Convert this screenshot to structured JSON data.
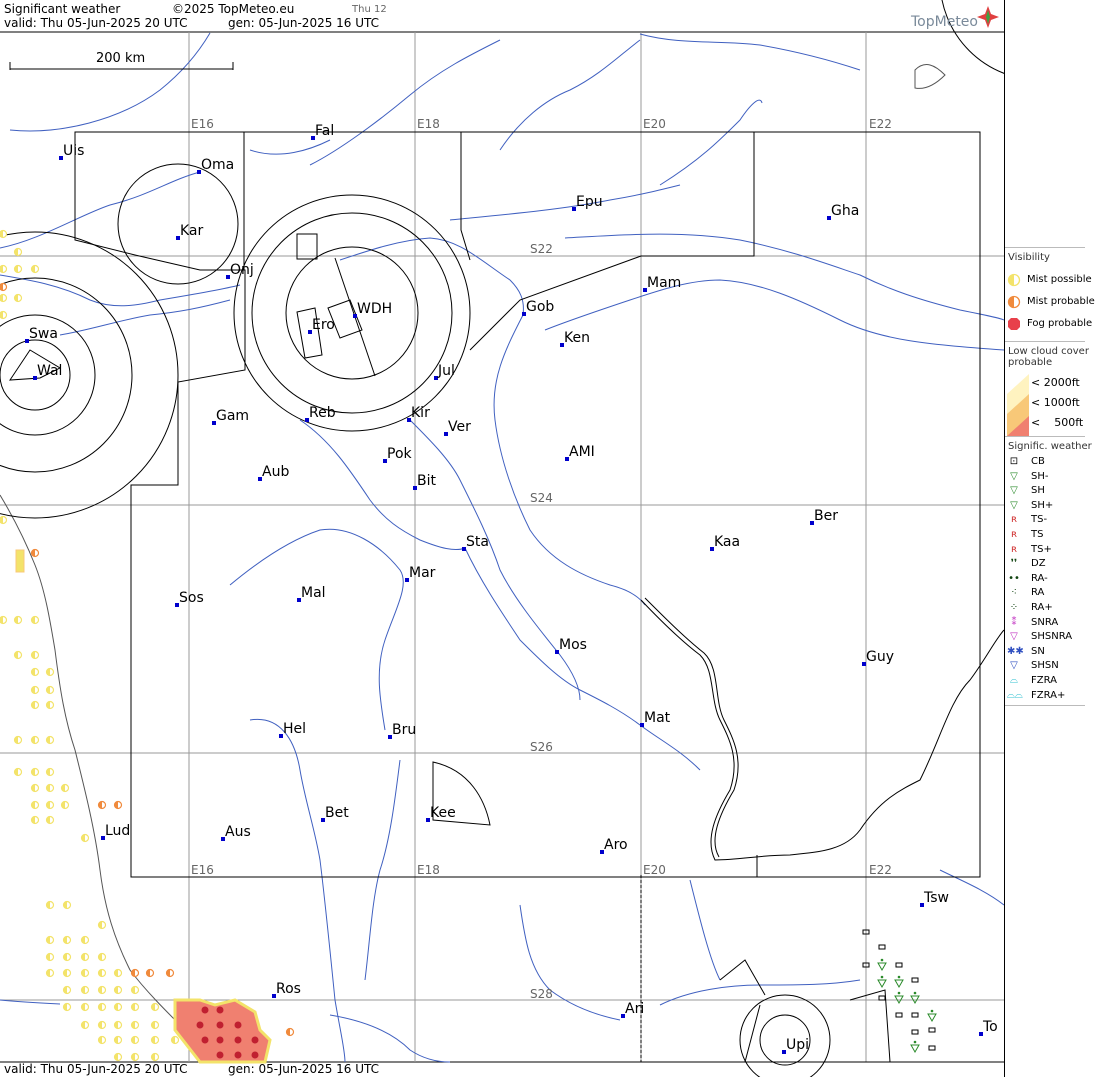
{
  "header": {
    "product": "Significant weather",
    "copyright": "©2025 TopMeteo.eu",
    "day_tag": "Thu 12",
    "valid": "valid:  Thu   05-Jun-2025  20 UTC",
    "gen": "gen: 05-Jun-2025 16 UTC",
    "logo": "TopMeteo"
  },
  "footer": {
    "valid": "valid:  Thu   05-Jun-2025  20 UTC",
    "gen": "gen: 05-Jun-2025 16 UTC"
  },
  "scale_bar": {
    "label": "200 km"
  },
  "grid": {
    "lon_labels": [
      "E16",
      "E18",
      "E20",
      "E22"
    ],
    "lat_labels": [
      "S22",
      "S24",
      "S26",
      "S28"
    ]
  },
  "cities": [
    "Uis",
    "Fal",
    "Oma",
    "Kar",
    "Onj",
    "Swa",
    "Wal",
    "Ero",
    "WDH",
    "Gob",
    "Mam",
    "Epu",
    "Gha",
    "Ken",
    "Jul",
    "Gam",
    "Reb",
    "Kir",
    "Ver",
    "Aub",
    "Pok",
    "Bit",
    "AMI",
    "Sta",
    "Kaa",
    "Ber",
    "Sos",
    "Mal",
    "Mar",
    "Mos",
    "Guy",
    "Hel",
    "Bru",
    "Mat",
    "Bet",
    "Kee",
    "Lud",
    "Aus",
    "Aro",
    "Tsw",
    "Ros",
    "Ari",
    "Upi",
    "To"
  ],
  "legend": {
    "visibility": {
      "title": "Visibility",
      "items": [
        "Mist possible",
        "Mist probable",
        "Fog probable"
      ],
      "colors": [
        "#f3e36a",
        "#f08a3c",
        "#e8404a"
      ]
    },
    "low_cloud": {
      "title": "Low cloud cover probable",
      "items": [
        "< 2000ft",
        "< 1000ft",
        "<    500ft"
      ],
      "colors": [
        "#fff3c0",
        "#f8c878",
        "#f08070"
      ]
    },
    "sigwx": {
      "title": "Signific. weather",
      "items": [
        "CB",
        "SH-",
        "SH",
        "SH+",
        "TS-",
        "TS",
        "TS+",
        "DZ",
        "RA-",
        "RA",
        "RA+",
        "SNRA",
        "SHSNRA",
        "SN",
        "SHSN",
        "FZRA",
        "FZRA+"
      ]
    }
  }
}
